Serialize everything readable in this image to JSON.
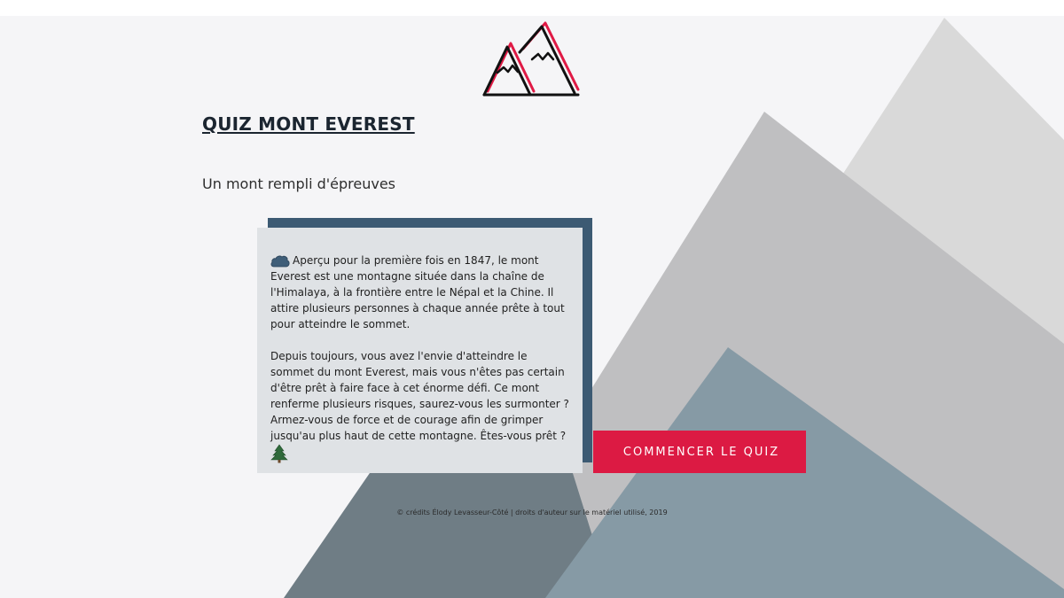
{
  "header": {
    "title": "QUIZ MONT EVEREST",
    "subtitle": "Un mont rempli d'épreuves"
  },
  "intro": {
    "paragraph1": "Aperçu pour la première fois en 1847, le mont Everest est une montagne située dans la chaîne de l'Himalaya, à la frontière entre le Népal et la Chine. Il attire plusieurs personnes à chaque année prête à tout pour atteindre le sommet.",
    "paragraph2": "Depuis toujours, vous avez l'envie d'atteindre le sommet du mont Everest, mais vous n'êtes pas certain d'être prêt à faire face à cet énorme défi. Ce mont renferme plusieurs risques, saurez-vous les surmonter ? Armez-vous de force et de courage afin de grimper jusqu'au plus haut de cette montagne. Êtes-vous prêt ?",
    "icon1": "cloud-icon",
    "icon2": "pine-tree-icon"
  },
  "actions": {
    "start_label": "COMMENCER LE QUIZ"
  },
  "footer": {
    "credits": "© crédits Élody Levasseur-Côté | droits d'auteur sur le matériel utilisé, 2019"
  },
  "colors": {
    "accent": "#dc1a43",
    "card_shadow": "#3c5a73",
    "card_bg": "#dfe2e5",
    "page_bg": "#f5f5f7",
    "mountain_light": "#d9d9d9",
    "mountain_mid": "#bfbfc1",
    "mountain_slate": "#869aa5",
    "mountain_dark": "#6f7d85"
  }
}
